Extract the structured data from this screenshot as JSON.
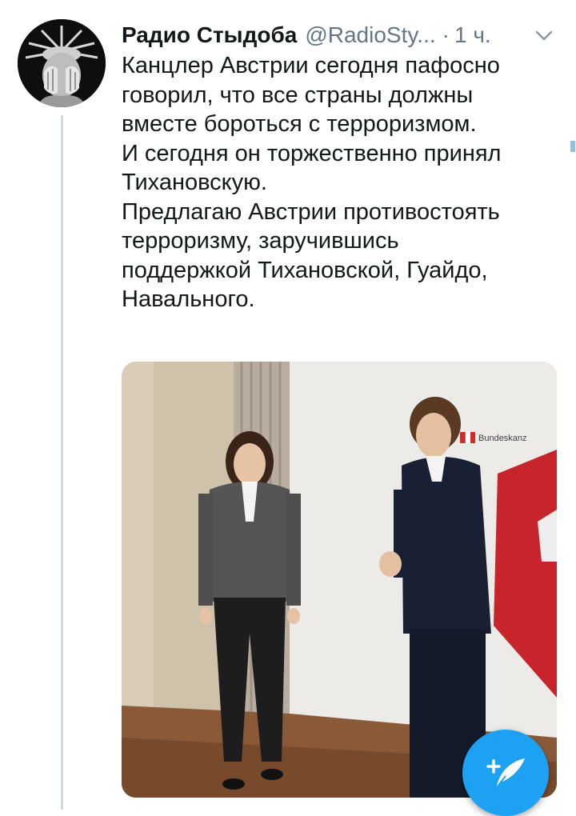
{
  "tweet": {
    "author_name": "Радио Стыдоба",
    "author_handle": "@RadioSty...",
    "separator": "·",
    "time": "1 ч.",
    "text_lines": [
      "Канцлер Австрии сегодня пафосно",
      "говорил, что все страны должны",
      "вместе бороться с терроризмом.",
      "И сегодня он торжественно принял",
      "Тихановскую.",
      "Предлагаю Австрии противостоять",
      "терроризму, заручившись",
      "поддержкой Тихановской, Гуайдо,",
      "Навального."
    ],
    "media": {
      "sign_text": "Bundeskanz"
    }
  },
  "icons": {
    "menu": "chevron-down-icon",
    "compose": "feather-plus-icon"
  },
  "colors": {
    "accent": "#1da1f2",
    "secondary_text": "#657786",
    "thread_line": "#cfd9de"
  }
}
